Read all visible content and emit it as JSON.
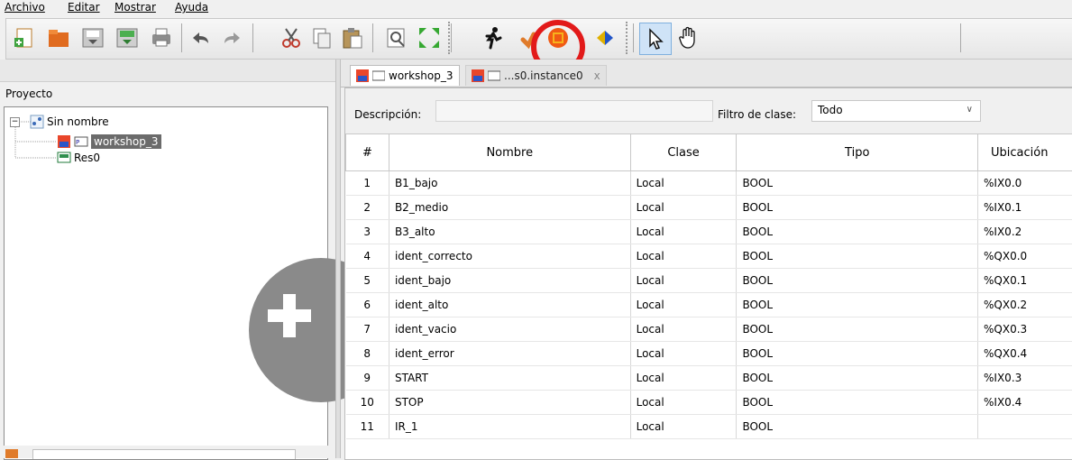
{
  "menu": [
    "Archivo",
    "Editar",
    "Mostrar",
    "Ayuda"
  ],
  "toolbar_icons": [
    "new-project-icon",
    "open-folder-icon",
    "save-icon",
    "save-as-icon",
    "print-icon",
    "undo-icon",
    "redo-icon",
    "cut-icon",
    "copy-icon",
    "paste-icon",
    "search-icon",
    "fullscreen-icon",
    "run-icon",
    "debug-icon",
    "plc-icon",
    "transfer-icon",
    "pointer-icon",
    "hand-icon"
  ],
  "colors": {
    "highlight_ring": "#e21a1a",
    "selected_tree_item": "#6b6b6b",
    "fab": "#8a8a8a"
  },
  "project": {
    "panel_title": "Proyecto",
    "root": "Sin nombre",
    "items": [
      "workshop_3",
      "Res0"
    ]
  },
  "tabs": [
    {
      "label": "workshop_3"
    },
    {
      "label": "...s0.instance0",
      "close": "x"
    }
  ],
  "filter": {
    "description_label": "Descripción:",
    "description_value": "",
    "class_filter_label": "Filtro de clase:",
    "class_filter_value": "Todo"
  },
  "table": {
    "headers": [
      "#",
      "Nombre",
      "Clase",
      "Tipo",
      "Ubicación"
    ],
    "rows": [
      [
        "1",
        "B1_bajo",
        "Local",
        "BOOL",
        "%IX0.0"
      ],
      [
        "2",
        "B2_medio",
        "Local",
        "BOOL",
        "%IX0.1"
      ],
      [
        "3",
        "B3_alto",
        "Local",
        "BOOL",
        "%IX0.2"
      ],
      [
        "4",
        "ident_correcto",
        "Local",
        "BOOL",
        "%QX0.0"
      ],
      [
        "5",
        "ident_bajo",
        "Local",
        "BOOL",
        "%QX0.1"
      ],
      [
        "6",
        "ident_alto",
        "Local",
        "BOOL",
        "%QX0.2"
      ],
      [
        "7",
        "ident_vacio",
        "Local",
        "BOOL",
        "%QX0.3"
      ],
      [
        "8",
        "ident_error",
        "Local",
        "BOOL",
        "%QX0.4"
      ],
      [
        "9",
        "START",
        "Local",
        "BOOL",
        "%IX0.3"
      ],
      [
        "10",
        "STOP",
        "Local",
        "BOOL",
        "%IX0.4"
      ],
      [
        "11",
        "IR_1",
        "Local",
        "BOOL",
        ""
      ]
    ]
  }
}
